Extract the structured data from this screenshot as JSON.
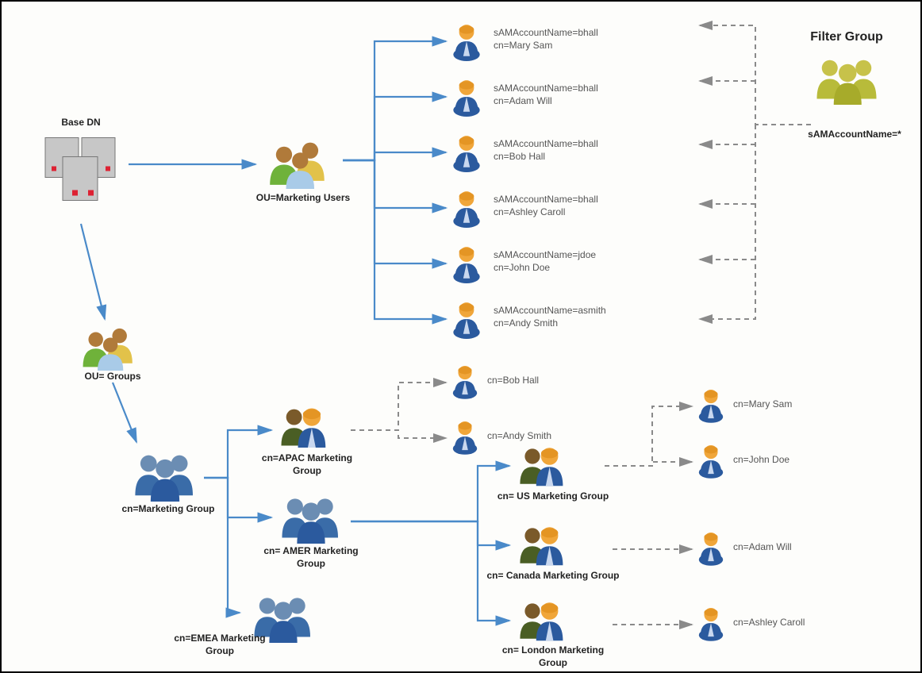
{
  "baseDN": {
    "title": "Base DN"
  },
  "filterGroup": {
    "title": "Filter Group",
    "filter": "sAMAccountName=*"
  },
  "ou": {
    "marketingUsers": "OU=Marketing Users",
    "groups": "OU= Groups"
  },
  "users": {
    "u1": {
      "sam": "sAMAccountName=bhall",
      "cn": "cn=Mary Sam"
    },
    "u2": {
      "sam": "sAMAccountName=bhall",
      "cn": "cn=Adam Will"
    },
    "u3": {
      "sam": "sAMAccountName=bhall",
      "cn": "cn=Bob Hall"
    },
    "u4": {
      "sam": "sAMAccountName=bhall",
      "cn": "cn=Ashley Caroll"
    },
    "u5": {
      "sam": "sAMAccountName=jdoe",
      "cn": "cn=John Doe"
    },
    "u6": {
      "sam": "sAMAccountName=asmith",
      "cn": "cn=Andy Smith"
    }
  },
  "groups": {
    "marketing": "cn=Marketing Group",
    "apac": "cn=APAC Marketing Group",
    "amer": "cn= AMER Marketing Group",
    "emea": "cn=EMEA Marketing Group",
    "us": "cn= US Marketing Group",
    "canada": "cn= Canada Marketing Group",
    "london": "cn= London Marketing Group"
  },
  "members": {
    "bob": "cn=Bob Hall",
    "andy": "cn=Andy Smith",
    "mary": "cn=Mary Sam",
    "john": "cn=John Doe",
    "adam": "cn=Adam Will",
    "ashley": "cn=Ashley Caroll"
  }
}
